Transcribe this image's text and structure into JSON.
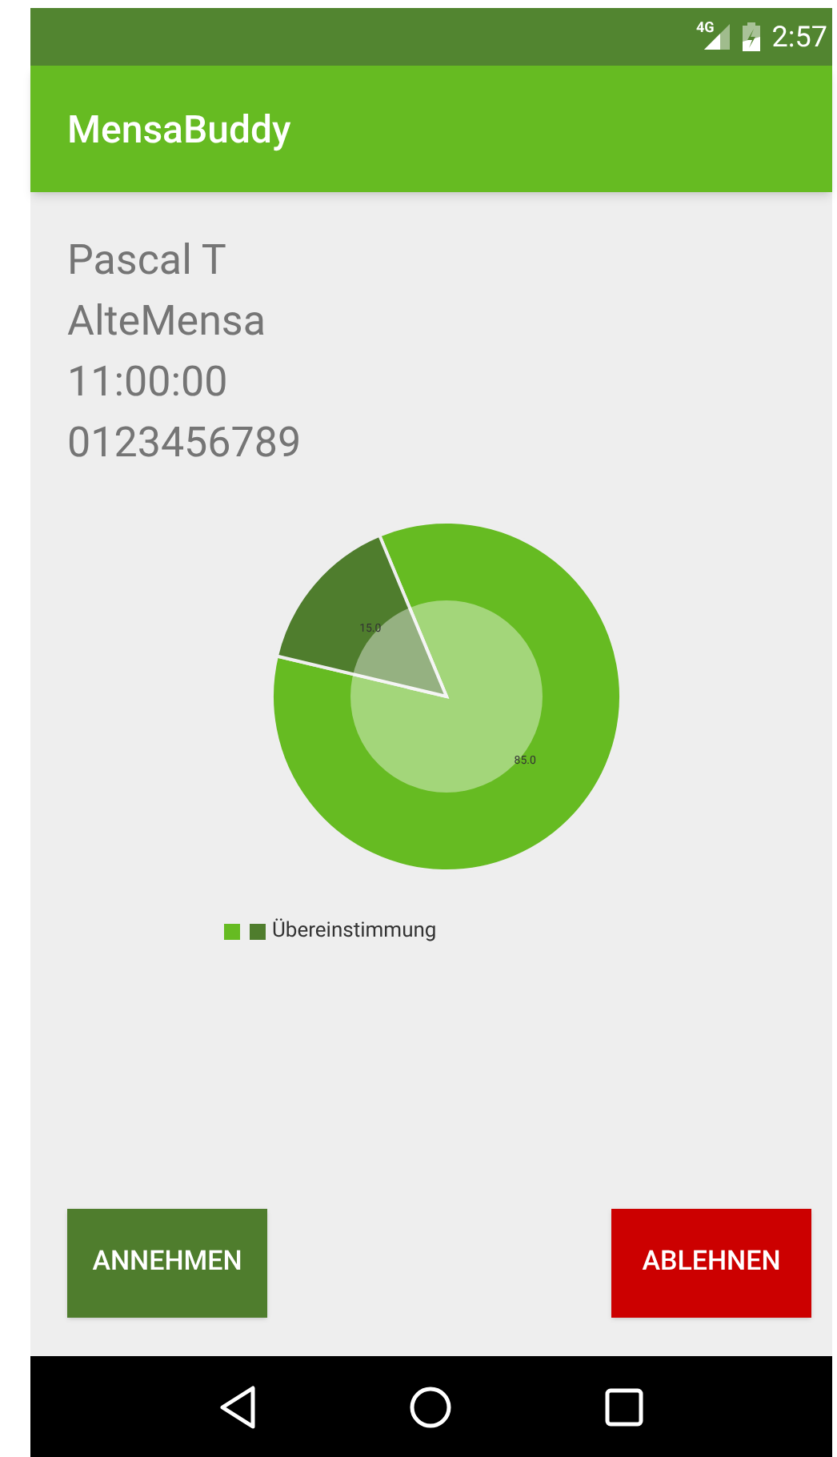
{
  "status_bar": {
    "network": "4G",
    "time": "2:57"
  },
  "app_bar": {
    "title": "MensaBuddy"
  },
  "details": [
    "Pascal T",
    "AlteMensa",
    "11:00:00",
    "0123456789"
  ],
  "chart_data": {
    "type": "donut",
    "series": [
      {
        "name": "Übereinstimmung",
        "values": [
          85,
          15
        ],
        "colors": [
          "#66bb22",
          "#4f7d2d"
        ]
      }
    ],
    "value_labels": [
      "85.0",
      "15.0"
    ]
  },
  "buttons": [
    {
      "label": "ANNEHMEN",
      "kind": "accept"
    },
    {
      "label": "ABLEHNEN",
      "kind": "reject"
    }
  ]
}
